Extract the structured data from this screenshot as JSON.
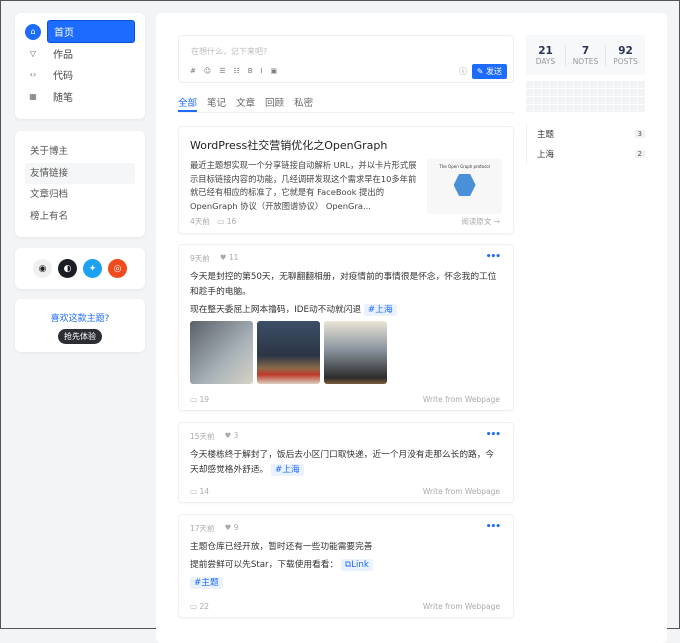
{
  "nav": {
    "items": [
      {
        "label": "首页",
        "icon": "home-icon",
        "active": true
      },
      {
        "label": "作品",
        "icon": "shirt-icon"
      },
      {
        "label": "代码",
        "icon": "code-icon"
      },
      {
        "label": "随笔",
        "icon": "note-icon"
      }
    ]
  },
  "links": [
    "关于博主",
    "友情链接",
    "文章归档",
    "榜上有名"
  ],
  "social": [
    {
      "icon": "rss-icon",
      "color": "#f0f0f0"
    },
    {
      "icon": "github-icon",
      "color": "#1b1f23"
    },
    {
      "icon": "twitter-icon",
      "color": "#1da1f2"
    },
    {
      "icon": "weibo-icon",
      "color": "#e6162d"
    }
  ],
  "theme": {
    "question": "喜欢这款主题?",
    "button": "抢先体验"
  },
  "editor": {
    "placeholder": "在想什么，记下来吧?",
    "tools": [
      "#",
      "☺",
      "☰",
      "☷",
      "B",
      "I",
      "▣"
    ],
    "send": "发送"
  },
  "tabs": [
    "全部",
    "笔记",
    "文章",
    "回顾",
    "私密"
  ],
  "posts": [
    {
      "title": "WordPress社交营销优化之OpenGraph",
      "excerpt": "最近主题想实现一个分享链接自动解析 URL，并以卡片形式展示目标链接内容的功能，几经调研发现这个需求早在10多年前就已经有相应的标准了，它就是有 FaceBook 提出的 OpenGraph 协议（开放图谱协议） OpenGra...",
      "time": "4天前",
      "comments": "16",
      "read": "阅读原文 →",
      "thumb": "The Open Graph protocol"
    },
    {
      "time": "9天前",
      "likes": "11",
      "p1": "今天是封控的第50天，无聊翻翻相册，对疫情前的事情很是怀念，怀念我的工位和趁手的电脑。",
      "p2": "现在整天委屈上网本撸码，IDE动不动就闪退",
      "tag": "#上海",
      "comments": "19",
      "source": "Write from Webpage"
    },
    {
      "time": "15天前",
      "likes": "3",
      "p1": "今天楼栋终于解封了，饭后去小区门口取快递，近一个月没有走那么长的路，今天却感觉格外舒适。",
      "tag": "#上海",
      "comments": "14",
      "source": "Write from Webpage"
    },
    {
      "time": "17天前",
      "likes": "9",
      "p1": "主题仓库已经开放，暂时还有一些功能需要完善",
      "p2": "提前尝鲜可以先Star，下载使用看看：",
      "link": "Link",
      "tag": "#主题",
      "comments": "22",
      "source": "Write from Webpage"
    }
  ],
  "stats": [
    {
      "n": "21",
      "l": "DAYS"
    },
    {
      "n": "7",
      "l": "NOTES"
    },
    {
      "n": "92",
      "l": "POSTS"
    }
  ],
  "tag_list": [
    {
      "name": "主题",
      "count": "3"
    },
    {
      "name": "上海",
      "count": "2"
    }
  ]
}
